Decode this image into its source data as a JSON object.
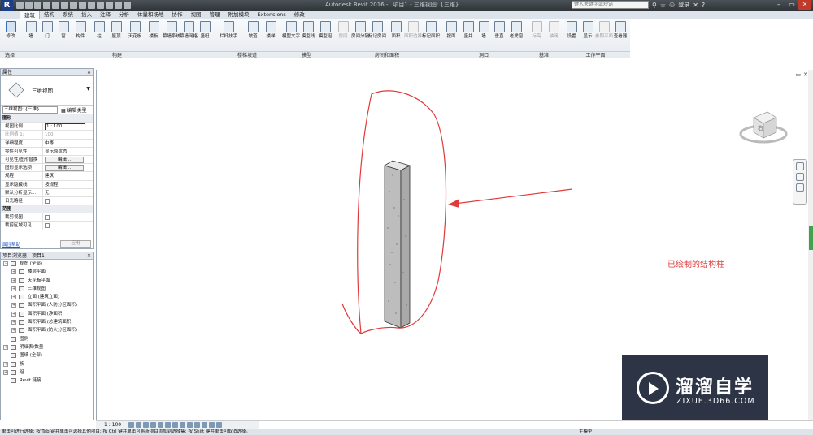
{
  "titlebar": {
    "app_title": "Autodesk Revit 2016 -",
    "project": "项目1 - 三维视图: {三维}",
    "search_placeholder": "键入关键字或短语",
    "login": "登录"
  },
  "ribbon_tabs": [
    "建筑",
    "结构",
    "系统",
    "插入",
    "注释",
    "分析",
    "体量和场地",
    "协作",
    "视图",
    "管理",
    "附加模块",
    "Extensions",
    "修改"
  ],
  "ribbon": {
    "buttons": [
      "修改",
      "墙",
      "门",
      "窗",
      "构件",
      "柱",
      "屋顶",
      "天花板",
      "楼板",
      "幕墙系统",
      "幕墙网格",
      "竖梃",
      "栏杆扶手",
      "坡道",
      "楼梯",
      "模型文字",
      "模型线",
      "模型组",
      "房间",
      "房间分隔",
      "标记房间",
      "面积",
      "面积边界",
      "标记面积",
      "按面",
      "竖井",
      "墙",
      "垂直",
      "老虎窗",
      "标高",
      "轴网",
      "设置",
      "显示",
      "参照平面",
      "查看器"
    ],
    "panels": [
      "选择",
      "构建",
      "楼梯坡道",
      "模型",
      "房间和面积",
      "洞口",
      "基准",
      "工作平面"
    ]
  },
  "properties": {
    "title": "属性",
    "type_name": "三维视图",
    "instance_selector": "三维视图: {三维}",
    "edit_type": "编辑类型",
    "rows": [
      {
        "k": "图形",
        "group": true
      },
      {
        "k": "视图比例",
        "v": "1 : 100",
        "style": "boxed"
      },
      {
        "k": "比例值 1:",
        "v": "100",
        "style": "dim"
      },
      {
        "k": "详细程度",
        "v": "中等"
      },
      {
        "k": "零件可见性",
        "v": "显示原状态"
      },
      {
        "k": "可见性/图形替换",
        "v": "编辑...",
        "style": "btn"
      },
      {
        "k": "图形显示选项",
        "v": "编辑...",
        "style": "btn"
      },
      {
        "k": "规程",
        "v": "建筑"
      },
      {
        "k": "显示隐藏线",
        "v": "按规程"
      },
      {
        "k": "默认分析显示...",
        "v": "无"
      },
      {
        "k": "日光路径",
        "v": "",
        "style": "check"
      },
      {
        "k": "范围",
        "group": true
      },
      {
        "k": "裁剪视图",
        "v": "",
        "style": "check"
      },
      {
        "k": "裁剪区域可见",
        "v": "",
        "style": "check"
      }
    ],
    "help_link": "属性帮助",
    "apply_label": "应用"
  },
  "browser": {
    "title": "项目浏览器 - 项目1",
    "items": [
      {
        "label": "视图 (全部)",
        "level": 0,
        "exp": "-"
      },
      {
        "label": "楼层平面",
        "level": 1,
        "exp": "+"
      },
      {
        "label": "天花板平面",
        "level": 1,
        "exp": "+"
      },
      {
        "label": "三维视图",
        "level": 1,
        "exp": "+"
      },
      {
        "label": "立面 (建筑立面)",
        "level": 1,
        "exp": "+"
      },
      {
        "label": "面积平面 (人防分区面积)",
        "level": 1,
        "exp": "+"
      },
      {
        "label": "面积平面 (净面积)",
        "level": 1,
        "exp": "+"
      },
      {
        "label": "面积平面 (总建筑面积)",
        "level": 1,
        "exp": "+"
      },
      {
        "label": "面积平面 (防火分区面积)",
        "level": 1,
        "exp": "+"
      },
      {
        "label": "图例",
        "level": 0,
        "exp": ""
      },
      {
        "label": "明细表/数量",
        "level": 0,
        "exp": "+"
      },
      {
        "label": "图纸 (全部)",
        "level": 0,
        "exp": ""
      },
      {
        "label": "族",
        "level": 0,
        "exp": "+"
      },
      {
        "label": "组",
        "level": 0,
        "exp": "+"
      },
      {
        "label": "Revit 链接",
        "level": 0,
        "exp": ""
      }
    ]
  },
  "canvas": {
    "annotation": "已绘制的结构柱",
    "viewcube_face": "右",
    "annotation_color": "#e03a3a"
  },
  "watermark": {
    "name": "溜溜自学",
    "url": "ZIXUE.3D66.COM"
  },
  "viewbar": {
    "scale": "1 : 100"
  },
  "statusbar": {
    "hint": "单击可进行选择; 按 Tab 键并单击可选择其他项目; 按 Ctrl 键并单击可将新项目添加到选择集; 按 Shift 键并单击可取消选择。",
    "model": "主模型"
  }
}
